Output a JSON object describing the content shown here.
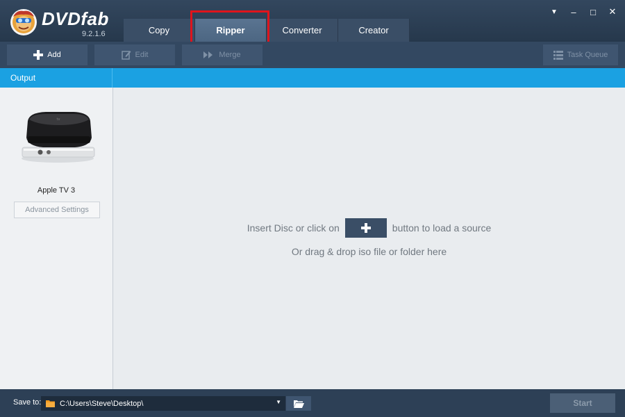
{
  "app": {
    "name": "DVDfab",
    "version": "9.2.1.6"
  },
  "tabs": [
    {
      "label": "Copy"
    },
    {
      "label": "Ripper",
      "active": true
    },
    {
      "label": "Converter"
    },
    {
      "label": "Creator"
    }
  ],
  "window_controls": {
    "menu": "▼",
    "minimize": "–",
    "maximize": "□",
    "close": "✕"
  },
  "toolbar": {
    "add_label": "Add",
    "edit_label": "Edit",
    "merge_label": "Merge",
    "task_queue_label": "Task Queue"
  },
  "output": {
    "header": "Output",
    "device_name": "Apple TV 3",
    "advanced_settings_label": "Advanced Settings"
  },
  "main": {
    "hint_before": "Insert Disc or click on",
    "hint_after": "button to load a source",
    "hint_drag": "Or drag & drop iso file or folder here"
  },
  "status": {
    "save_to_label": "Save to:",
    "path": "C:\\Users\\Steve\\Desktop\\",
    "start_label": "Start"
  },
  "colors": {
    "accent_blue": "#1ba1e2",
    "highlight_red": "#e0141c",
    "folder_orange": "#f39a1e"
  }
}
